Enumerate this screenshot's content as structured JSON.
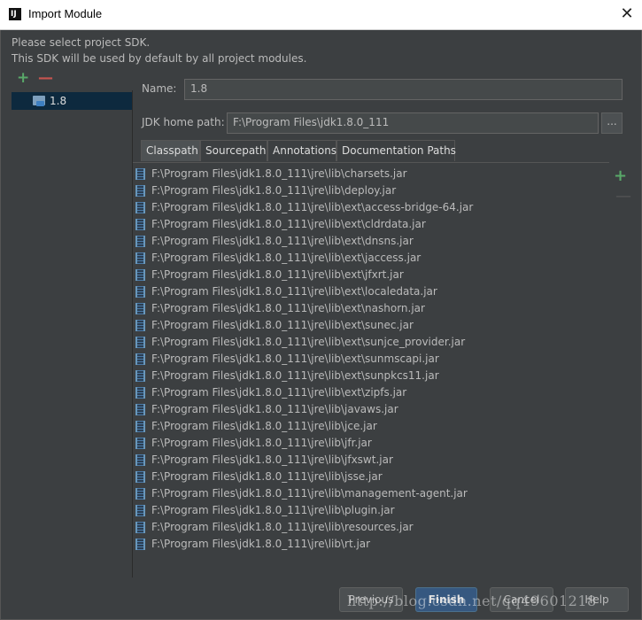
{
  "window": {
    "title": "Import Module",
    "close": "✕",
    "logo": "IJ"
  },
  "message": {
    "line1": "Please select project SDK.",
    "line2": "This SDK will be used by default by all project modules."
  },
  "sdk_toolbar": {
    "add": "+",
    "remove": "—"
  },
  "sdk_list": [
    {
      "label": "1.8"
    }
  ],
  "form": {
    "name_label": "Name:",
    "name_value": "1.8",
    "jdk_label": "JDK home path:",
    "jdk_value": "F:\\Program Files\\jdk1.8.0_111",
    "browse": "..."
  },
  "tabs": [
    "Classpath",
    "Sourcepath",
    "Annotations",
    "Documentation Paths"
  ],
  "active_tab": "Classpath",
  "classpath": [
    "F:\\Program Files\\jdk1.8.0_111\\jre\\lib\\charsets.jar",
    "F:\\Program Files\\jdk1.8.0_111\\jre\\lib\\deploy.jar",
    "F:\\Program Files\\jdk1.8.0_111\\jre\\lib\\ext\\access-bridge-64.jar",
    "F:\\Program Files\\jdk1.8.0_111\\jre\\lib\\ext\\cldrdata.jar",
    "F:\\Program Files\\jdk1.8.0_111\\jre\\lib\\ext\\dnsns.jar",
    "F:\\Program Files\\jdk1.8.0_111\\jre\\lib\\ext\\jaccess.jar",
    "F:\\Program Files\\jdk1.8.0_111\\jre\\lib\\ext\\jfxrt.jar",
    "F:\\Program Files\\jdk1.8.0_111\\jre\\lib\\ext\\localedata.jar",
    "F:\\Program Files\\jdk1.8.0_111\\jre\\lib\\ext\\nashorn.jar",
    "F:\\Program Files\\jdk1.8.0_111\\jre\\lib\\ext\\sunec.jar",
    "F:\\Program Files\\jdk1.8.0_111\\jre\\lib\\ext\\sunjce_provider.jar",
    "F:\\Program Files\\jdk1.8.0_111\\jre\\lib\\ext\\sunmscapi.jar",
    "F:\\Program Files\\jdk1.8.0_111\\jre\\lib\\ext\\sunpkcs11.jar",
    "F:\\Program Files\\jdk1.8.0_111\\jre\\lib\\ext\\zipfs.jar",
    "F:\\Program Files\\jdk1.8.0_111\\jre\\lib\\javaws.jar",
    "F:\\Program Files\\jdk1.8.0_111\\jre\\lib\\jce.jar",
    "F:\\Program Files\\jdk1.8.0_111\\jre\\lib\\jfr.jar",
    "F:\\Program Files\\jdk1.8.0_111\\jre\\lib\\jfxswt.jar",
    "F:\\Program Files\\jdk1.8.0_111\\jre\\lib\\jsse.jar",
    "F:\\Program Files\\jdk1.8.0_111\\jre\\lib\\management-agent.jar",
    "F:\\Program Files\\jdk1.8.0_111\\jre\\lib\\plugin.jar",
    "F:\\Program Files\\jdk1.8.0_111\\jre\\lib\\resources.jar",
    "F:\\Program Files\\jdk1.8.0_111\\jre\\lib\\rt.jar"
  ],
  "classpath_toolbar": {
    "add": "+",
    "remove": "—"
  },
  "buttons": {
    "previous": "Previous",
    "finish": "Finish",
    "cancel": "Cancel",
    "help": "Help"
  },
  "watermark": "http://blog.csdn.net/qq49601218",
  "colors": {
    "background": "#3c3f41",
    "selection": "#0d293e",
    "add": "#59a869",
    "remove": "#c75450",
    "default_button": "#365880"
  }
}
